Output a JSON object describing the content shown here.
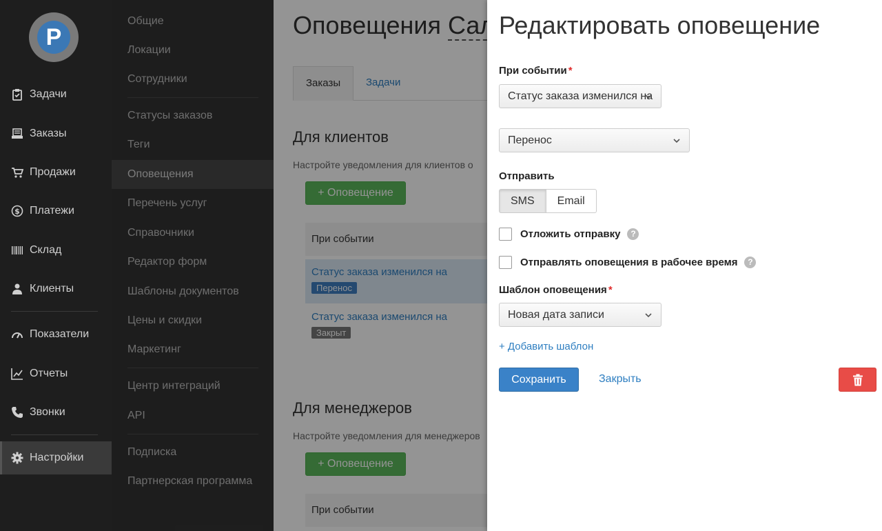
{
  "sidebar": {
    "logo_letter": "P",
    "items": [
      {
        "label": "Задачи",
        "icon": "clipboard-check-icon"
      },
      {
        "label": "Заказы",
        "icon": "inbox-tray-icon"
      },
      {
        "label": "Продажи",
        "icon": "shopping-cart-icon"
      },
      {
        "label": "Платежи",
        "icon": "dollar-coin-icon"
      },
      {
        "label": "Склад",
        "icon": "barcode-icon"
      },
      {
        "label": "Клиенты",
        "icon": "user-icon"
      },
      {
        "label": "Показатели",
        "icon": "gauge-icon"
      },
      {
        "label": "Отчеты",
        "icon": "line-chart-icon"
      },
      {
        "label": "Звонки",
        "icon": "phone-icon"
      },
      {
        "label": "Настройки",
        "icon": "gear-icon"
      }
    ]
  },
  "submenu": {
    "items": [
      "Общие",
      "Локации",
      "Сотрудники",
      "Статусы заказов",
      "Теги",
      "Оповещения",
      "Перечень услуг",
      "Справочники",
      "Редактор форм",
      "Шаблоны документов",
      "Цены и скидки",
      "Маркетинг",
      "Центр интеграций",
      "API",
      "Подписка",
      "Партнерская программа"
    ]
  },
  "main": {
    "title": "Оповещения",
    "title_sub": "Сал",
    "tabs": [
      "Заказы",
      "Задачи"
    ],
    "clients": {
      "title": "Для клиентов",
      "desc": "Настройте уведомления для клиентов о",
      "add_button": "+ Оповещение",
      "col_header": "При событии",
      "rows": [
        {
          "event": "Статус заказа изменился на",
          "badge": "Перенос"
        },
        {
          "event": "Статус заказа изменился на",
          "badge": "Закрыт"
        }
      ]
    },
    "managers": {
      "title": "Для менеджеров",
      "desc": "Настройте уведомления для менеджеров",
      "add_button": "+ Оповещение",
      "col_header": "При событии"
    }
  },
  "panel": {
    "title": "Редактировать оповещение",
    "event_label": "При событии",
    "required_mark": "*",
    "event_value": "Статус заказа изменился на",
    "status_value": "Перенос",
    "send_label": "Отправить",
    "send_options": [
      "SMS",
      "Email"
    ],
    "delay_label": "Отложить отправку",
    "worktime_label": "Отправлять оповещения в рабочее время",
    "help_glyph": "?",
    "template_label": "Шаблон оповещения",
    "template_value": "Новая дата записи",
    "add_template_link": "+ Добавить шаблон",
    "save_button": "Сохранить",
    "close_link": "Закрыть"
  },
  "colors": {
    "primary": "#3a82c8",
    "success": "#5cb85c",
    "danger": "#e84c47",
    "link": "#2f7fc1",
    "sidebar": "#1e1e1e",
    "submenu": "#333333"
  }
}
